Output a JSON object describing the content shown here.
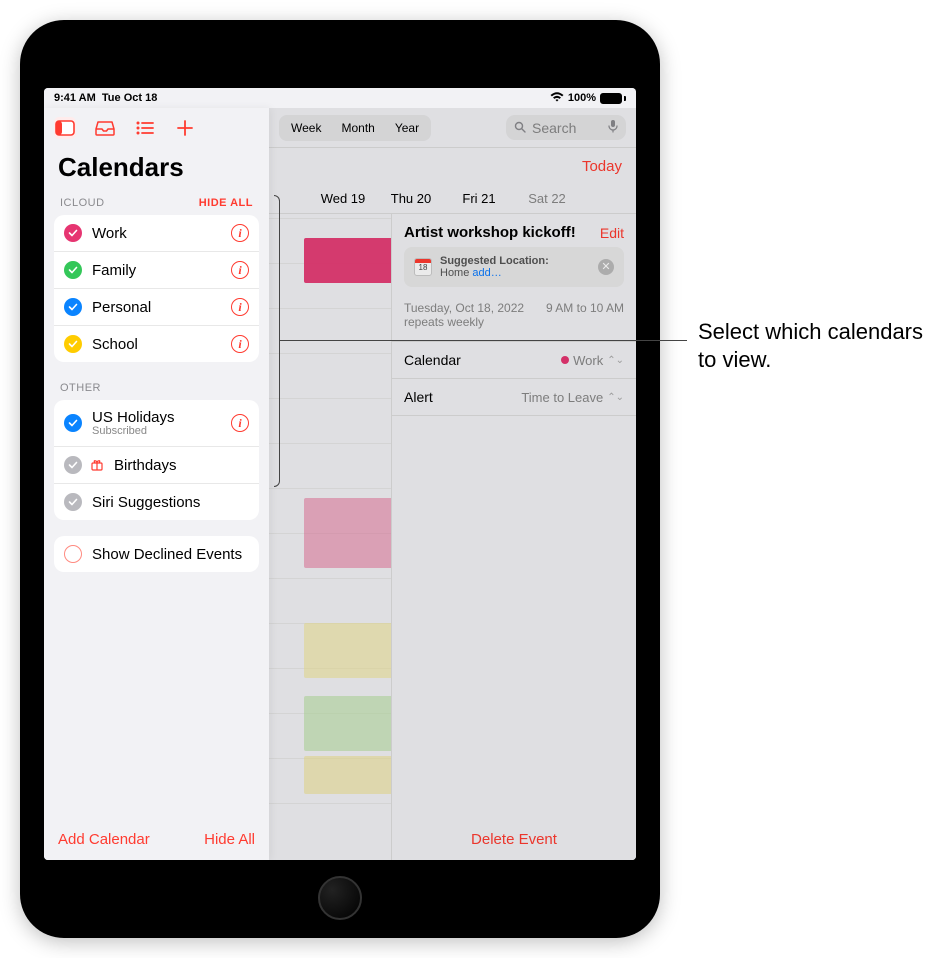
{
  "status": {
    "time": "9:41 AM",
    "date": "Tue Oct 18",
    "battery": "100%"
  },
  "sidebar": {
    "title": "Calendars",
    "sections": {
      "icloud": {
        "label": "ICLOUD",
        "hide_all": "HIDE ALL"
      },
      "other": {
        "label": "OTHER"
      }
    },
    "icloud_items": [
      {
        "name": "Work",
        "color": "#e63571"
      },
      {
        "name": "Family",
        "color": "#34c759"
      },
      {
        "name": "Personal",
        "color": "#0a84ff"
      },
      {
        "name": "School",
        "color": "#ffcc00"
      }
    ],
    "other_items": [
      {
        "name": "US Holidays",
        "sub": "Subscribed",
        "color": "#0a84ff",
        "info": true
      },
      {
        "name": "Birthdays",
        "color": "#b9b9be"
      },
      {
        "name": "Siri Suggestions",
        "color": "#b9b9be"
      }
    ],
    "show_declined": "Show Declined Events",
    "footer": {
      "add": "Add Calendar",
      "hide": "Hide All"
    }
  },
  "main": {
    "view_segments": [
      "Week",
      "Month",
      "Year"
    ],
    "search_placeholder": "Search",
    "today": "Today",
    "weekdays": [
      "Wed 19",
      "Thu 20",
      "Fri 21",
      "Sat 22"
    ]
  },
  "event": {
    "title": "Artist workshop kickoff!",
    "edit": "Edit",
    "suggested_label": "Suggested Location:",
    "suggested_value_prefix": "Home ",
    "suggested_link": "add…",
    "date_line": "Tuesday, Oct 18, 2022",
    "time_line": "9 AM to 10 AM",
    "repeats": "repeats weekly",
    "calendar_label": "Calendar",
    "calendar_value": "Work",
    "alert_label": "Alert",
    "alert_value": "Time to Leave",
    "delete": "Delete Event",
    "day_badge": "18"
  },
  "callout": "Select which calendars to view."
}
